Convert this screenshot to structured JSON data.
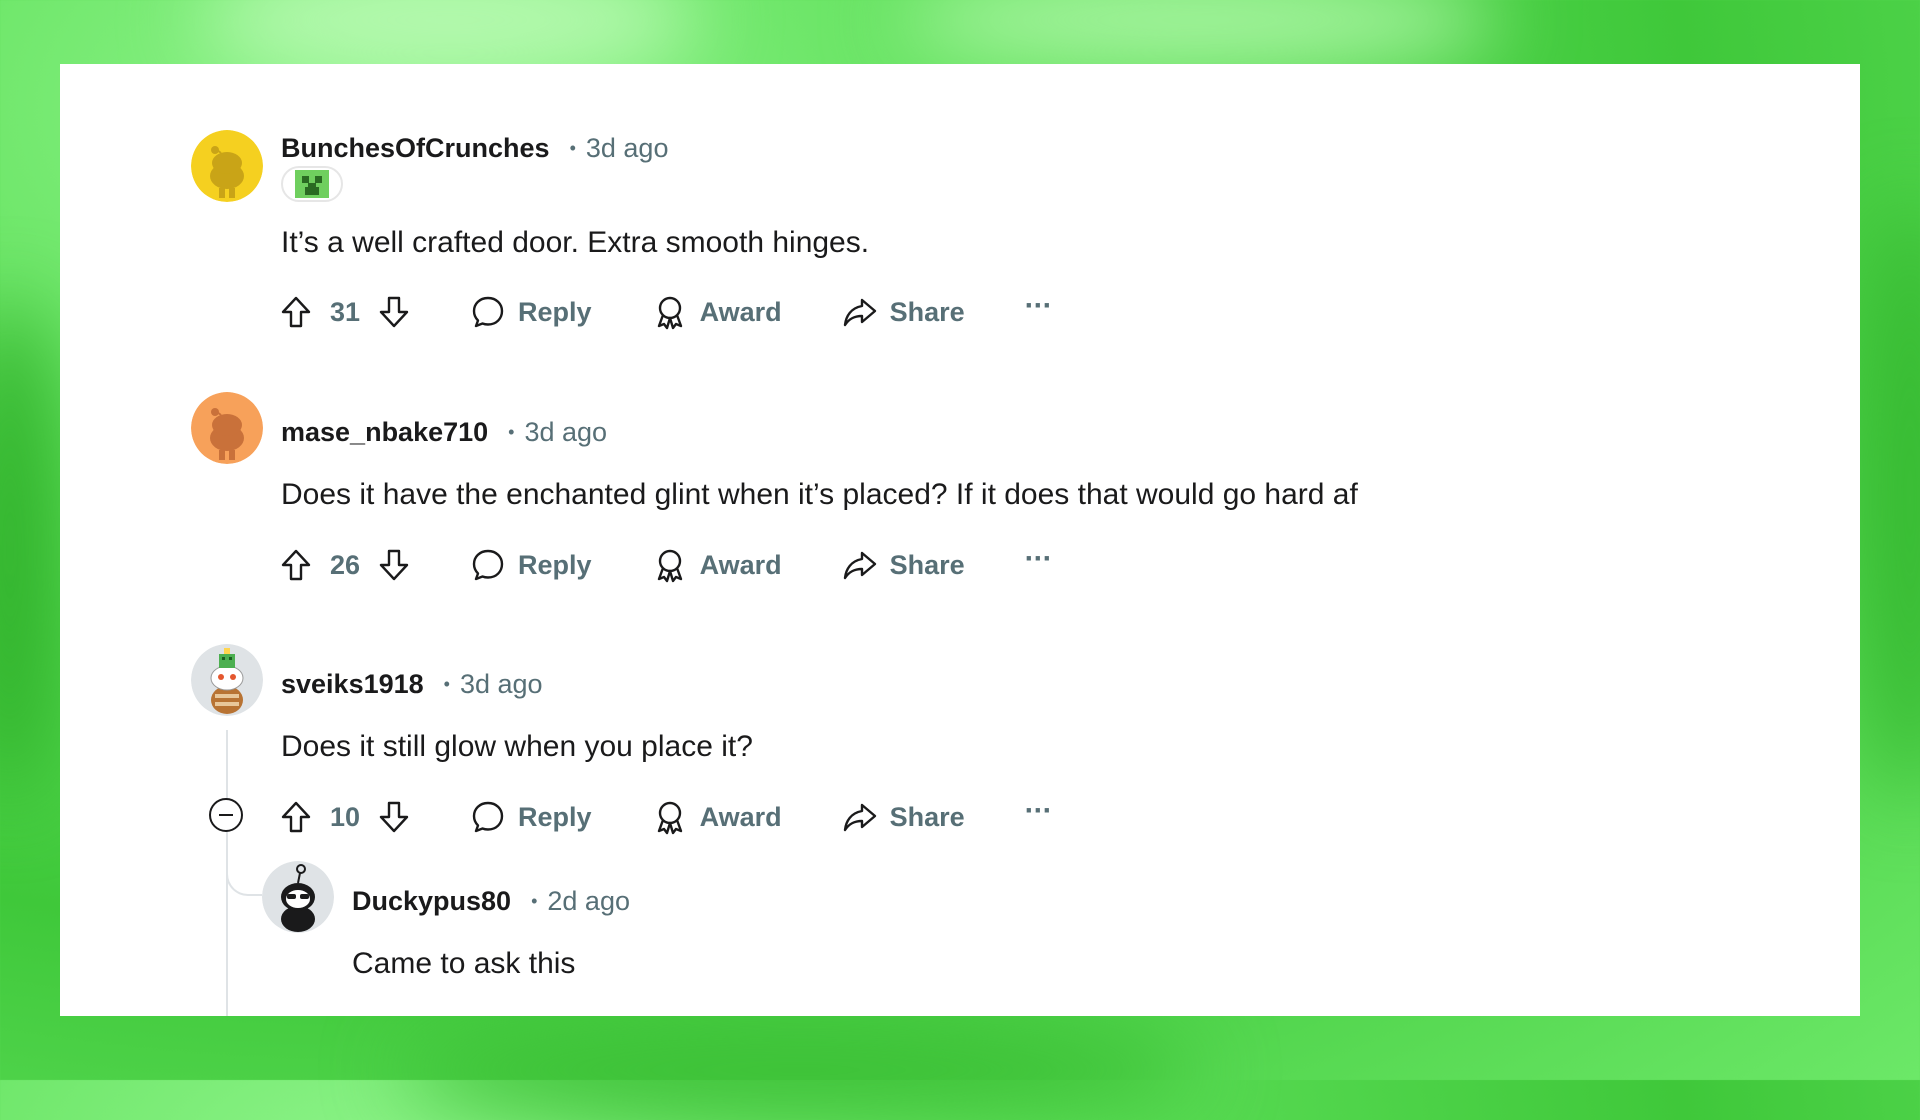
{
  "comments": [
    {
      "username": "BunchesOfCrunches",
      "time": "3d ago",
      "text": "It’s a well crafted door. Extra smooth hinges.",
      "votes": "31",
      "reply_label": "Reply",
      "award_label": "Award",
      "share_label": "Share",
      "more_label": "···",
      "avatar_color": "#f5d020"
    },
    {
      "username": "mase_nbake710",
      "time": "3d ago",
      "text": "Does it have the enchanted glint when it’s placed? If it does that would go hard af",
      "votes": "26",
      "reply_label": "Reply",
      "award_label": "Award",
      "share_label": "Share",
      "more_label": "···",
      "avatar_color": "#f7a15a"
    },
    {
      "username": "sveiks1918",
      "time": "3d ago",
      "text": "Does it still glow when you place it?",
      "votes": "10",
      "reply_label": "Reply",
      "award_label": "Award",
      "share_label": "Share",
      "more_label": "···",
      "avatar_color": "#dfe3e6"
    },
    {
      "username": "Duckypus80",
      "time": "2d ago",
      "text": "Came to ask this",
      "avatar_color": "#dfe3e6"
    }
  ],
  "dot": "•",
  "colors": {
    "background": "#5fe05a",
    "card": "#ffffff",
    "text_primary": "#1a1a1b",
    "text_secondary": "#576f76"
  }
}
